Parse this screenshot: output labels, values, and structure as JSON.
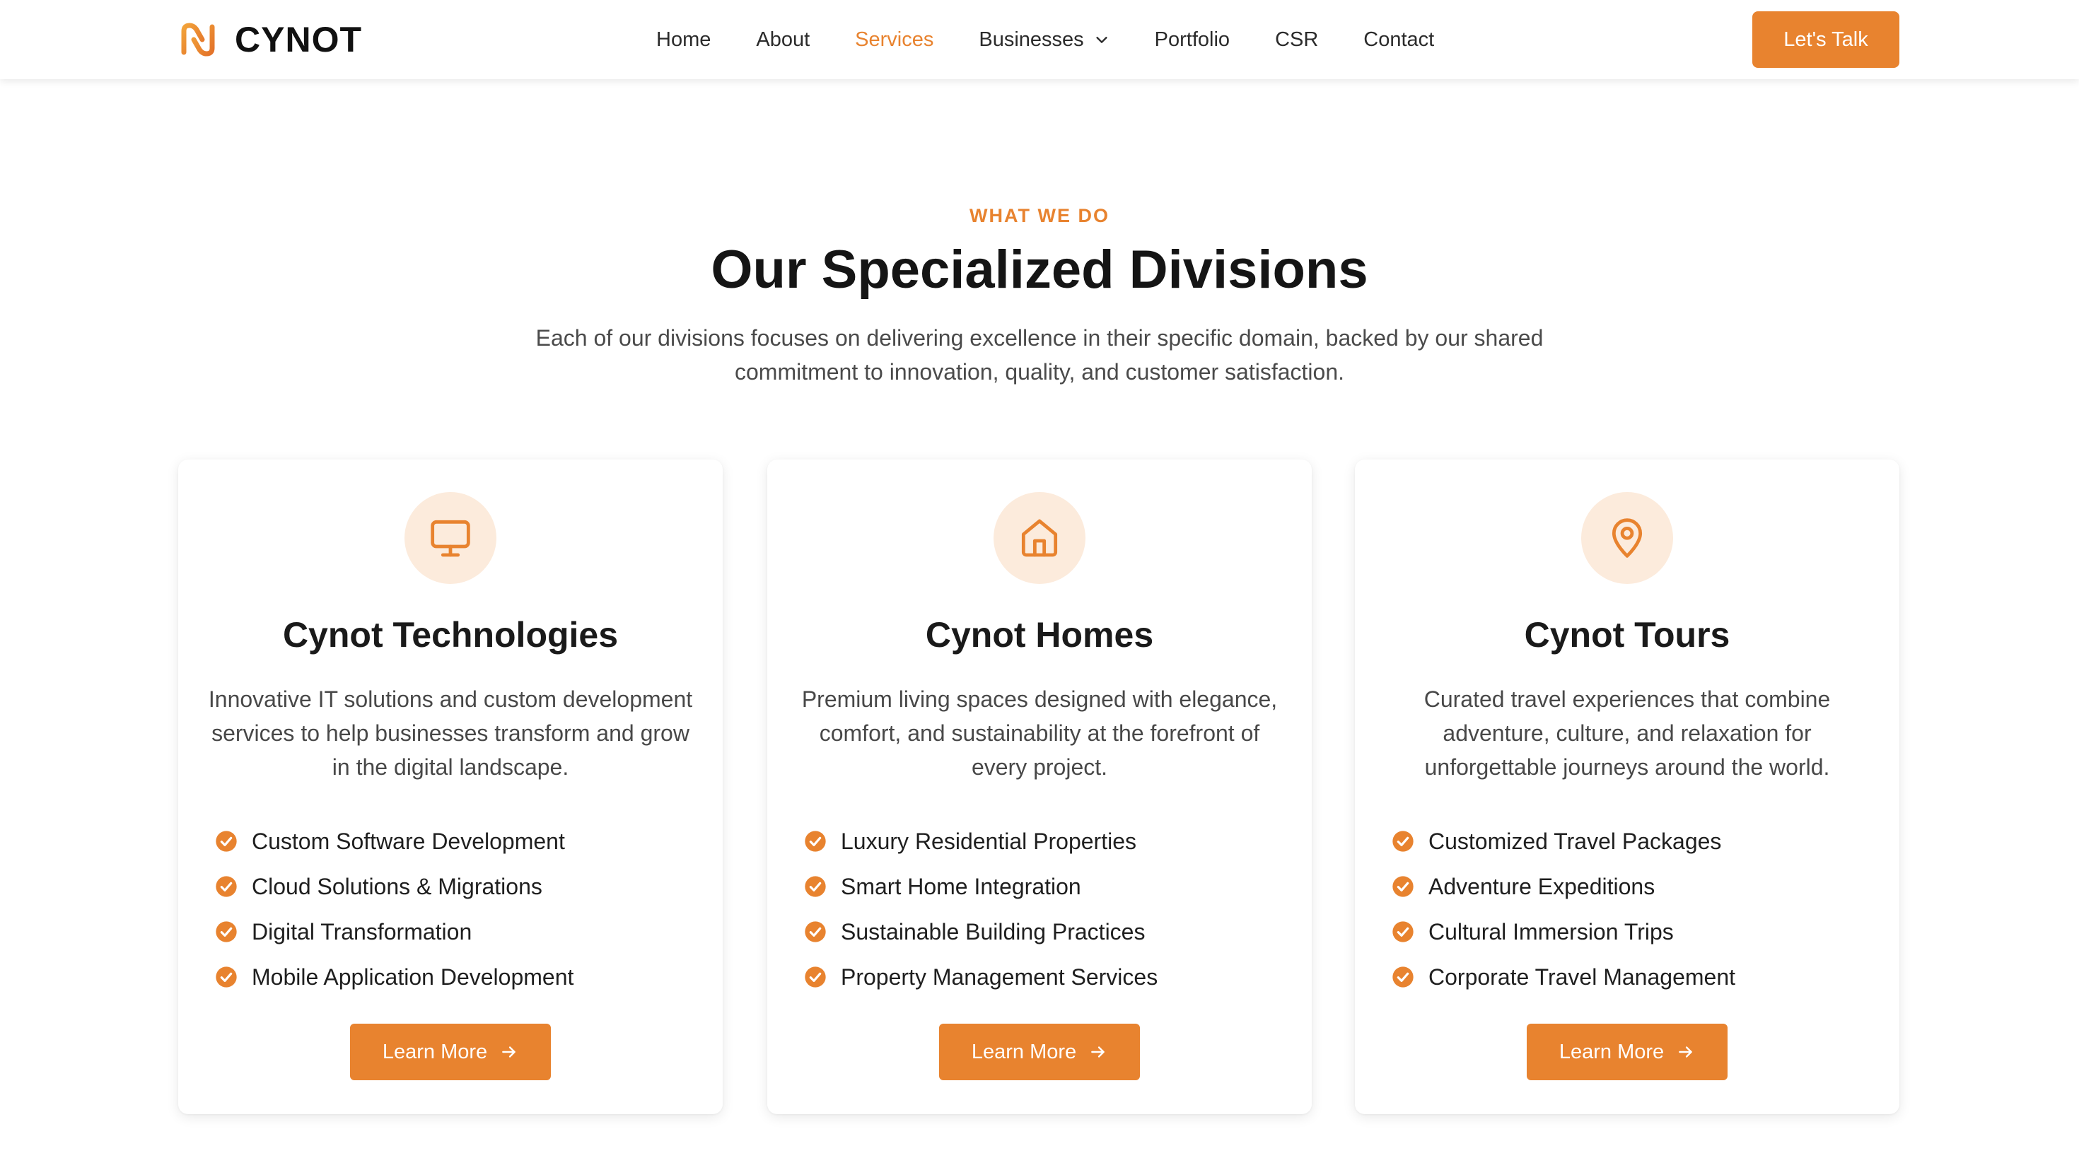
{
  "header": {
    "brand": "CYNOT",
    "nav": [
      {
        "label": "Home",
        "active": false
      },
      {
        "label": "About",
        "active": false
      },
      {
        "label": "Services",
        "active": true
      },
      {
        "label": "Businesses",
        "active": false,
        "has_dropdown": true
      },
      {
        "label": "Portfolio",
        "active": false
      },
      {
        "label": "CSR",
        "active": false
      },
      {
        "label": "Contact",
        "active": false
      }
    ],
    "cta_label": "Let's Talk"
  },
  "section": {
    "eyebrow": "WHAT WE DO",
    "title": "Our Specialized Divisions",
    "subtitle": "Each of our divisions focuses on delivering excellence in their specific domain, backed by our shared commitment to innovation, quality, and customer satisfaction."
  },
  "cards": [
    {
      "icon": "monitor-icon",
      "title": "Cynot Technologies",
      "description": "Innovative IT solutions and custom development services to help businesses transform and grow in the digital landscape.",
      "features": [
        "Custom Software Development",
        "Cloud Solutions & Migrations",
        "Digital Transformation",
        "Mobile Application Development"
      ],
      "button_label": "Learn More"
    },
    {
      "icon": "home-icon",
      "title": "Cynot Homes",
      "description": "Premium living spaces designed with elegance, comfort, and sustainability at the forefront of every project.",
      "features": [
        "Luxury Residential Properties",
        "Smart Home Integration",
        "Sustainable Building Practices",
        "Property Management Services"
      ],
      "button_label": "Learn More"
    },
    {
      "icon": "map-pin-icon",
      "title": "Cynot Tours",
      "description": "Curated travel experiences that combine adventure, culture, and relaxation for unforgettable journeys around the world.",
      "features": [
        "Customized Travel Packages",
        "Adventure Expeditions",
        "Cultural Immersion Trips",
        "Corporate Travel Management"
      ],
      "button_label": "Learn More"
    }
  ],
  "colors": {
    "accent": "#e8832f",
    "icon_background": "#fcebdc",
    "heading": "#151515",
    "body_text": "#4a4a4a"
  }
}
